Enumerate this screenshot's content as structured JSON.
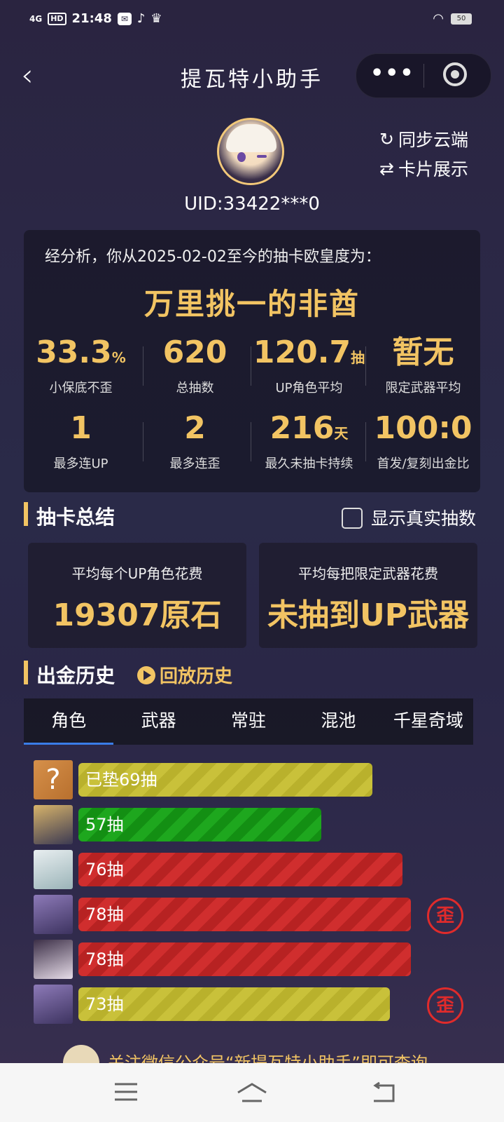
{
  "status_bar": {
    "network": "4G",
    "hd": "HD",
    "time": "21:48",
    "battery": "50"
  },
  "nav": {
    "back": "‹",
    "title": "提瓦特小助手",
    "more": "•••"
  },
  "header": {
    "uid": "UID:33422***0",
    "sync": "同步云端",
    "card_show": "卡片展示"
  },
  "summary": {
    "intro": "经分析，你从2025-02-02至今的抽卡欧皇度为：",
    "verdict": "万里挑一的非酋",
    "stats": [
      {
        "value": "33.3",
        "unit": "%",
        "label": "小保底不歪"
      },
      {
        "value": "620",
        "unit": "",
        "label": "总抽数"
      },
      {
        "value": "120.7",
        "unit": "抽",
        "label": "UP角色平均"
      },
      {
        "value": "暂无",
        "unit": "",
        "label": "限定武器平均"
      },
      {
        "value": "1",
        "unit": "",
        "label": "最多连UP"
      },
      {
        "value": "2",
        "unit": "",
        "label": "最多连歪"
      },
      {
        "value": "216",
        "unit": "天",
        "label": "最久未抽卡持续"
      },
      {
        "value": "100:0",
        "unit": "",
        "label": "首发/复刻出金比"
      }
    ]
  },
  "draw_summary": {
    "title": "抽卡总结",
    "show_real_label": "显示真实抽数",
    "card_left_title": "平均每个UP角色花费",
    "card_left_value": "19307原石",
    "card_right_title": "平均每把限定武器花费",
    "card_right_value": "未抽到UP武器"
  },
  "history": {
    "title": "出金历史",
    "replay": "回放历史",
    "tabs": [
      "角色",
      "武器",
      "常驻",
      "混池",
      "千星奇域"
    ],
    "rows": [
      {
        "text": "已垫69抽",
        "color": "yellow",
        "ratio": 0.69,
        "stamp": ""
      },
      {
        "text": "57抽",
        "color": "green",
        "ratio": 0.57,
        "stamp": ""
      },
      {
        "text": "76抽",
        "color": "red",
        "ratio": 0.76,
        "stamp": ""
      },
      {
        "text": "78抽",
        "color": "red",
        "ratio": 0.78,
        "stamp": "歪"
      },
      {
        "text": "78抽",
        "color": "red",
        "ratio": 0.78,
        "stamp": ""
      },
      {
        "text": "73抽",
        "color": "yellow",
        "ratio": 0.73,
        "stamp": "歪"
      }
    ],
    "unknown_icon": "?"
  },
  "footer": {
    "text": "关注微信公众号“新提瓦特小助手”即可查询"
  },
  "colors": {
    "gold": "#f2c463",
    "bg": "#2a2440",
    "tab_active": "#3a7de8"
  }
}
